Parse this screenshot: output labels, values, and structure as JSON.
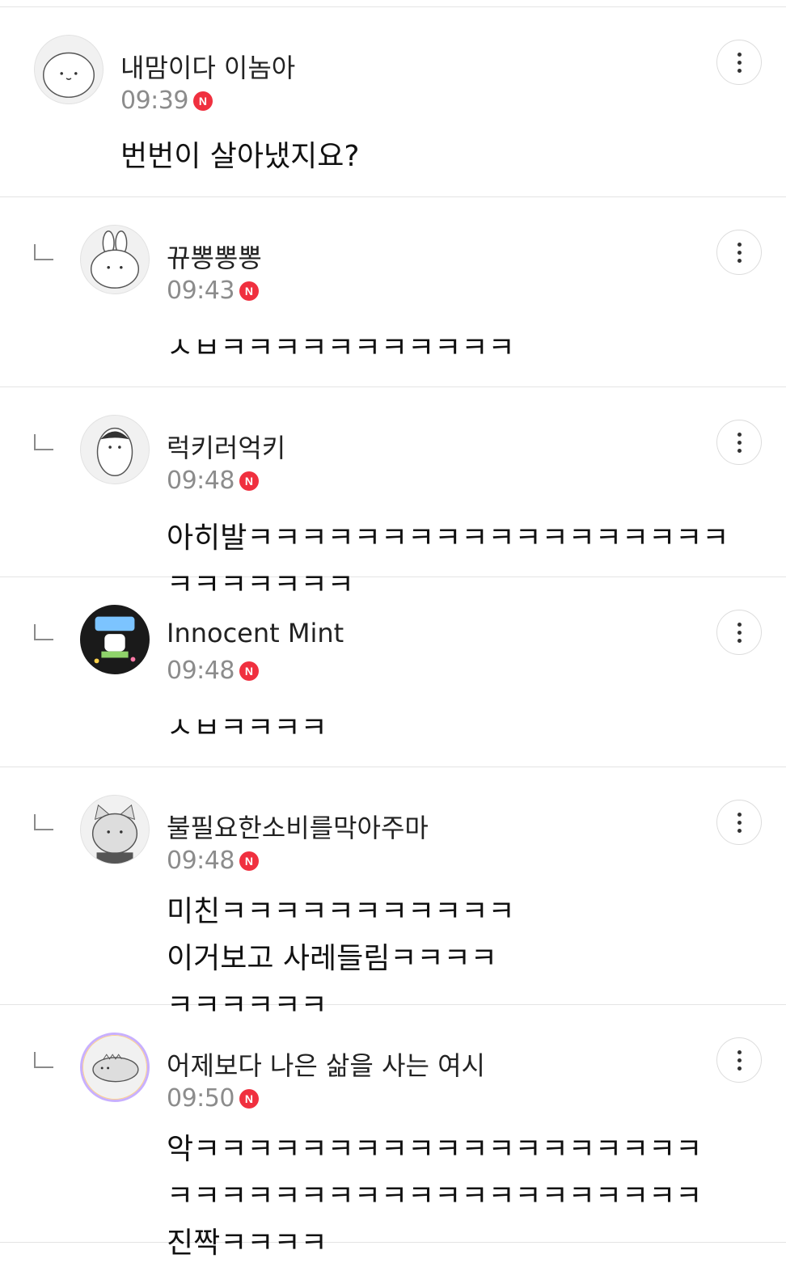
{
  "comments": [
    {
      "name": "내맘이다 이놈아",
      "time": "09:39",
      "badge": "N",
      "text": "번번이 살아냈지요?",
      "avatar_icon": "seal-character-avatar-icon",
      "is_reply": false
    },
    {
      "name": "뀨뽕뽕뽕",
      "time": "09:43",
      "badge": "N",
      "text": "ㅅㅂㅋㅋㅋㅋㅋㅋㅋㅋㅋㅋㅋ",
      "avatar_icon": "bunny-character-avatar-icon",
      "is_reply": true
    },
    {
      "name": "럭키러억키",
      "time": "09:48",
      "badge": "N",
      "text": "아히발ㅋㅋㅋㅋㅋㅋㅋㅋㅋㅋㅋㅋㅋㅋㅋㅋㅋㅋㅋㅋㅋㅋㅋㅋㅋ",
      "avatar_icon": "penguin-character-avatar-icon",
      "is_reply": true
    },
    {
      "name": "Innocent Mint",
      "time": "09:48",
      "badge": "N",
      "text": "ㅅㅂㅋㅋㅋㅋ",
      "avatar_icon": "custom-photo-avatar-icon",
      "is_reply": true
    },
    {
      "name": "불필요한소비를막아주마",
      "time": "09:48",
      "badge": "N",
      "text": "미친ㅋㅋㅋㅋㅋㅋㅋㅋㅋㅋㅋ이거보고 사레들림ㅋㅋㅋㅋㅋㅋㅋㅋㅋㅋ",
      "avatar_icon": "cat-character-avatar-icon",
      "is_reply": true
    },
    {
      "name": "어제보다 나은 삶을 사는 여시",
      "time": "09:50",
      "badge": "N",
      "text": "악ㅋㅋㅋㅋㅋㅋㅋㅋㅋㅋㅋㅋㅋㅋㅋㅋㅋㅋㅋㅋㅋㅋㅋㅋㅋㅋㅋㅋㅋㅋㅋㅋㅋㅋㅋㅋㅋㅋㅋ진짝ㅋㅋㅋㅋ",
      "avatar_icon": "dinosaur-character-avatar-icon",
      "is_reply": true
    }
  ],
  "icons": {
    "more": "more-vertical-icon",
    "reply": "reply-arrow-icon",
    "new_badge": "new-badge-icon"
  },
  "colors": {
    "badge": "#f0303f",
    "time": "#8c8c8c",
    "divider": "#e4e4e4"
  }
}
